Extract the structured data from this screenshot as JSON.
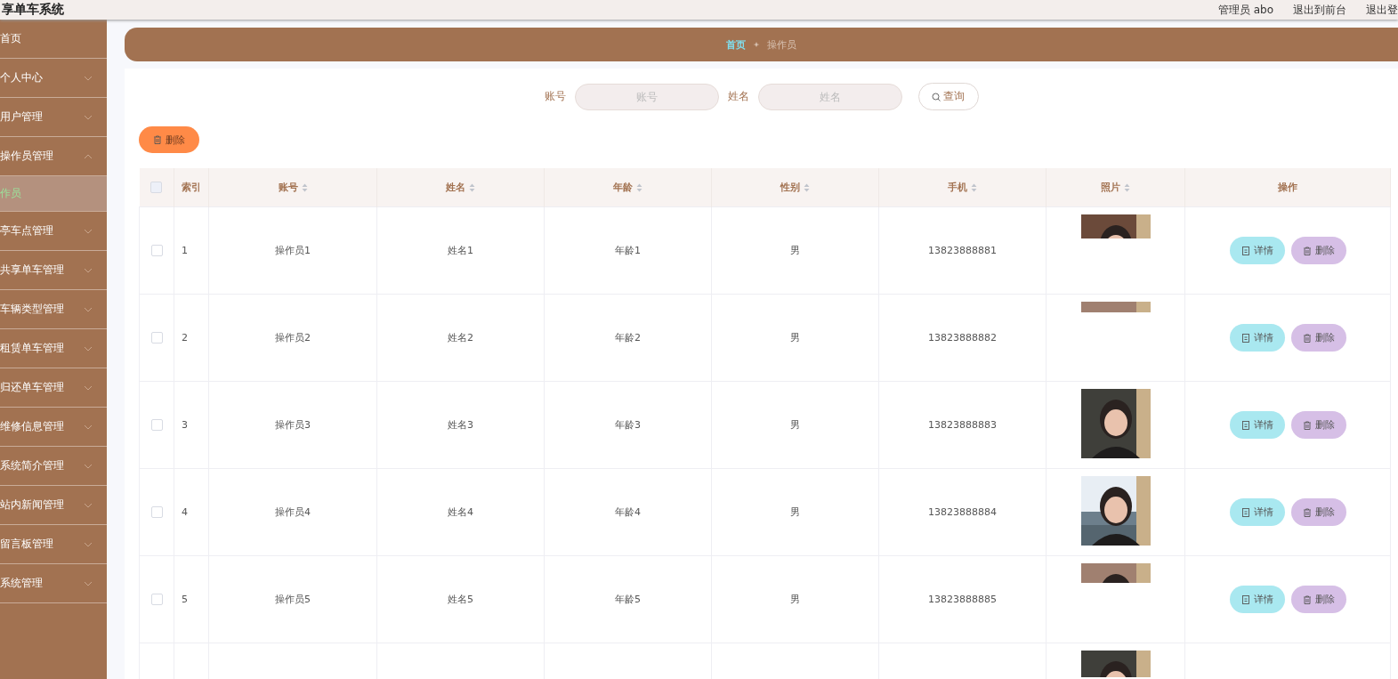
{
  "header": {
    "title": "享单车系统",
    "links": [
      "管理员 abo",
      "退出到前台",
      "退出登"
    ]
  },
  "sidebar": {
    "items": [
      {
        "label": "首页"
      },
      {
        "label": "个人中心",
        "expandable": true,
        "expanded": false
      },
      {
        "label": "用户管理",
        "expandable": true,
        "expanded": false
      },
      {
        "label": "操作员管理",
        "expandable": true,
        "expanded": true,
        "children": [
          {
            "label": "作员",
            "selected": true
          }
        ]
      },
      {
        "label": "亭车点管理",
        "expandable": true,
        "expanded": false
      },
      {
        "label": "共享单车管理",
        "expandable": true,
        "expanded": false
      },
      {
        "label": "车辆类型管理",
        "expandable": true,
        "expanded": false
      },
      {
        "label": "租赁单车管理",
        "expandable": true,
        "expanded": false
      },
      {
        "label": "归还单车管理",
        "expandable": true,
        "expanded": false
      },
      {
        "label": "维修信息管理",
        "expandable": true,
        "expanded": false
      },
      {
        "label": "系统简介管理",
        "expandable": true,
        "expanded": false
      },
      {
        "label": "站内新闻管理",
        "expandable": true,
        "expanded": false
      },
      {
        "label": "留言板管理",
        "expandable": true,
        "expanded": false
      },
      {
        "label": "系统管理",
        "expandable": true,
        "expanded": false
      }
    ]
  },
  "breadcrumb": [
    {
      "label": "首页",
      "selected": true
    },
    {
      "label": "操作员",
      "selected": false
    }
  ],
  "search": {
    "fields": [
      {
        "label": "账号",
        "placeholder": "账号"
      },
      {
        "label": "姓名",
        "placeholder": "姓名"
      }
    ],
    "button": "查询"
  },
  "toolbar": {
    "delete_button": "删除"
  },
  "table": {
    "select_all": {
      "checked": false
    },
    "columns": [
      {
        "label": "索引",
        "sortable": false
      },
      {
        "label": "账号",
        "sortable": true
      },
      {
        "label": "姓名",
        "sortable": true
      },
      {
        "label": "年龄",
        "sortable": true
      },
      {
        "label": "性别",
        "sortable": true
      },
      {
        "label": "手机",
        "sortable": true
      },
      {
        "label": "照片",
        "sortable": true
      },
      {
        "label": "操作",
        "sortable": false
      }
    ],
    "rows": [
      {
        "checked": false,
        "cells": [
          "1",
          "操作员1",
          "姓名1",
          "年龄1",
          "男",
          "13823888881"
        ],
        "photo": {
          "kind": "picture"
        },
        "actions": [
          "详情",
          "删除"
        ]
      },
      {
        "checked": false,
        "cells": [
          "2",
          "操作员2",
          "姓名2",
          "年龄2",
          "男",
          "13823888882"
        ],
        "photo": {
          "kind": "picture"
        },
        "actions": [
          "详情",
          "删除"
        ]
      },
      {
        "checked": false,
        "cells": [
          "3",
          "操作员3",
          "姓名3",
          "年龄3",
          "男",
          "13823888883"
        ],
        "photo": {
          "kind": "picture"
        },
        "actions": [
          "详情",
          "删除"
        ]
      },
      {
        "checked": false,
        "cells": [
          "4",
          "操作员4",
          "姓名4",
          "年龄4",
          "男",
          "13823888884"
        ],
        "photo": {
          "kind": "picture"
        },
        "actions": [
          "详情",
          "删除"
        ]
      },
      {
        "checked": false,
        "cells": [
          "5",
          "操作员5",
          "姓名5",
          "年龄5",
          "男",
          "13823888885"
        ],
        "photo": {
          "kind": "picture"
        },
        "actions": [
          "详情",
          "删除"
        ]
      },
      {
        "photo": {
          "kind": "picture"
        }
      }
    ]
  }
}
